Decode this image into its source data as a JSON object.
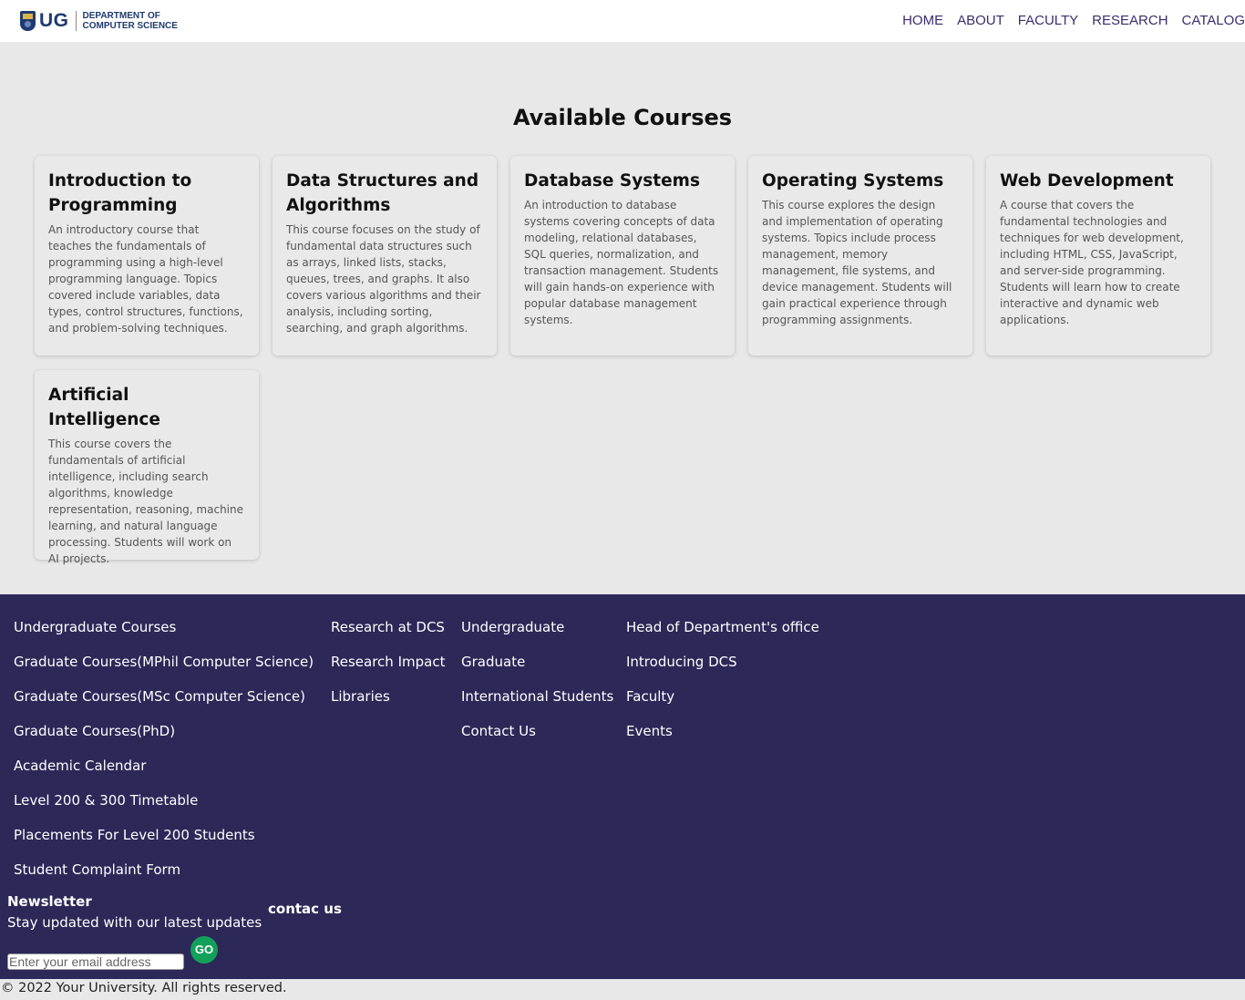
{
  "header": {
    "logo_text": "UG",
    "logo_dept_line1": "DEPARTMENT OF",
    "logo_dept_line2": "COMPUTER SCIENCE",
    "nav": [
      "HOME",
      "ABOUT",
      "FACULTY",
      "RESEARCH",
      "CATALOG"
    ]
  },
  "main": {
    "title": "Available Courses",
    "courses": [
      {
        "title": "Introduction to Programming",
        "description": "An introductory course that teaches the fundamentals of programming using a high-level programming language. Topics covered include variables, data types, control structures, functions, and problem-solving techniques."
      },
      {
        "title": "Data Structures and Algorithms",
        "description": "This course focuses on the study of fundamental data structures such as arrays, linked lists, stacks, queues, trees, and graphs. It also covers various algorithms and their analysis, including sorting, searching, and graph algorithms."
      },
      {
        "title": "Database Systems",
        "description": "An introduction to database systems covering concepts of data modeling, relational databases, SQL queries, normalization, and transaction management. Students will gain hands-on experience with popular database management systems."
      },
      {
        "title": "Operating Systems",
        "description": "This course explores the design and implementation of operating systems. Topics include process management, memory management, file systems, and device management. Students will gain practical experience through programming assignments."
      },
      {
        "title": "Web Development",
        "description": "A course that covers the fundamental technologies and techniques for web development, including HTML, CSS, JavaScript, and server-side programming. Students will learn how to create interactive and dynamic web applications."
      },
      {
        "title": "Artificial Intelligence",
        "description": "This course covers the fundamentals of artificial intelligence, including search algorithms, knowledge representation, reasoning, machine learning, and natural language processing. Students will work on AI projects."
      }
    ]
  },
  "footer": {
    "col1": [
      "Undergraduate Courses",
      "Graduate Courses(MPhil Computer Science)",
      "Graduate Courses(MSc Computer Science)",
      "Graduate Courses(PhD)",
      "Academic Calendar",
      "Level 200 & 300 Timetable",
      "Placements For Level 200 Students",
      "Student Complaint Form"
    ],
    "col2": [
      "Research at DCS",
      "Research Impact",
      "Libraries"
    ],
    "col3": [
      "Undergraduate",
      "Graduate",
      "International Students",
      "Contact Us"
    ],
    "col4": [
      "Head of Department's office",
      "Introducing DCS",
      "Faculty",
      "Events"
    ],
    "newsletter_title": "Newsletter",
    "newsletter_sub": "Stay updated with our latest updates",
    "email_placeholder": "Enter your email address",
    "go_label": "GO",
    "contact_label": "contac us"
  },
  "copyright": "© 2022 Your University. All rights reserved."
}
